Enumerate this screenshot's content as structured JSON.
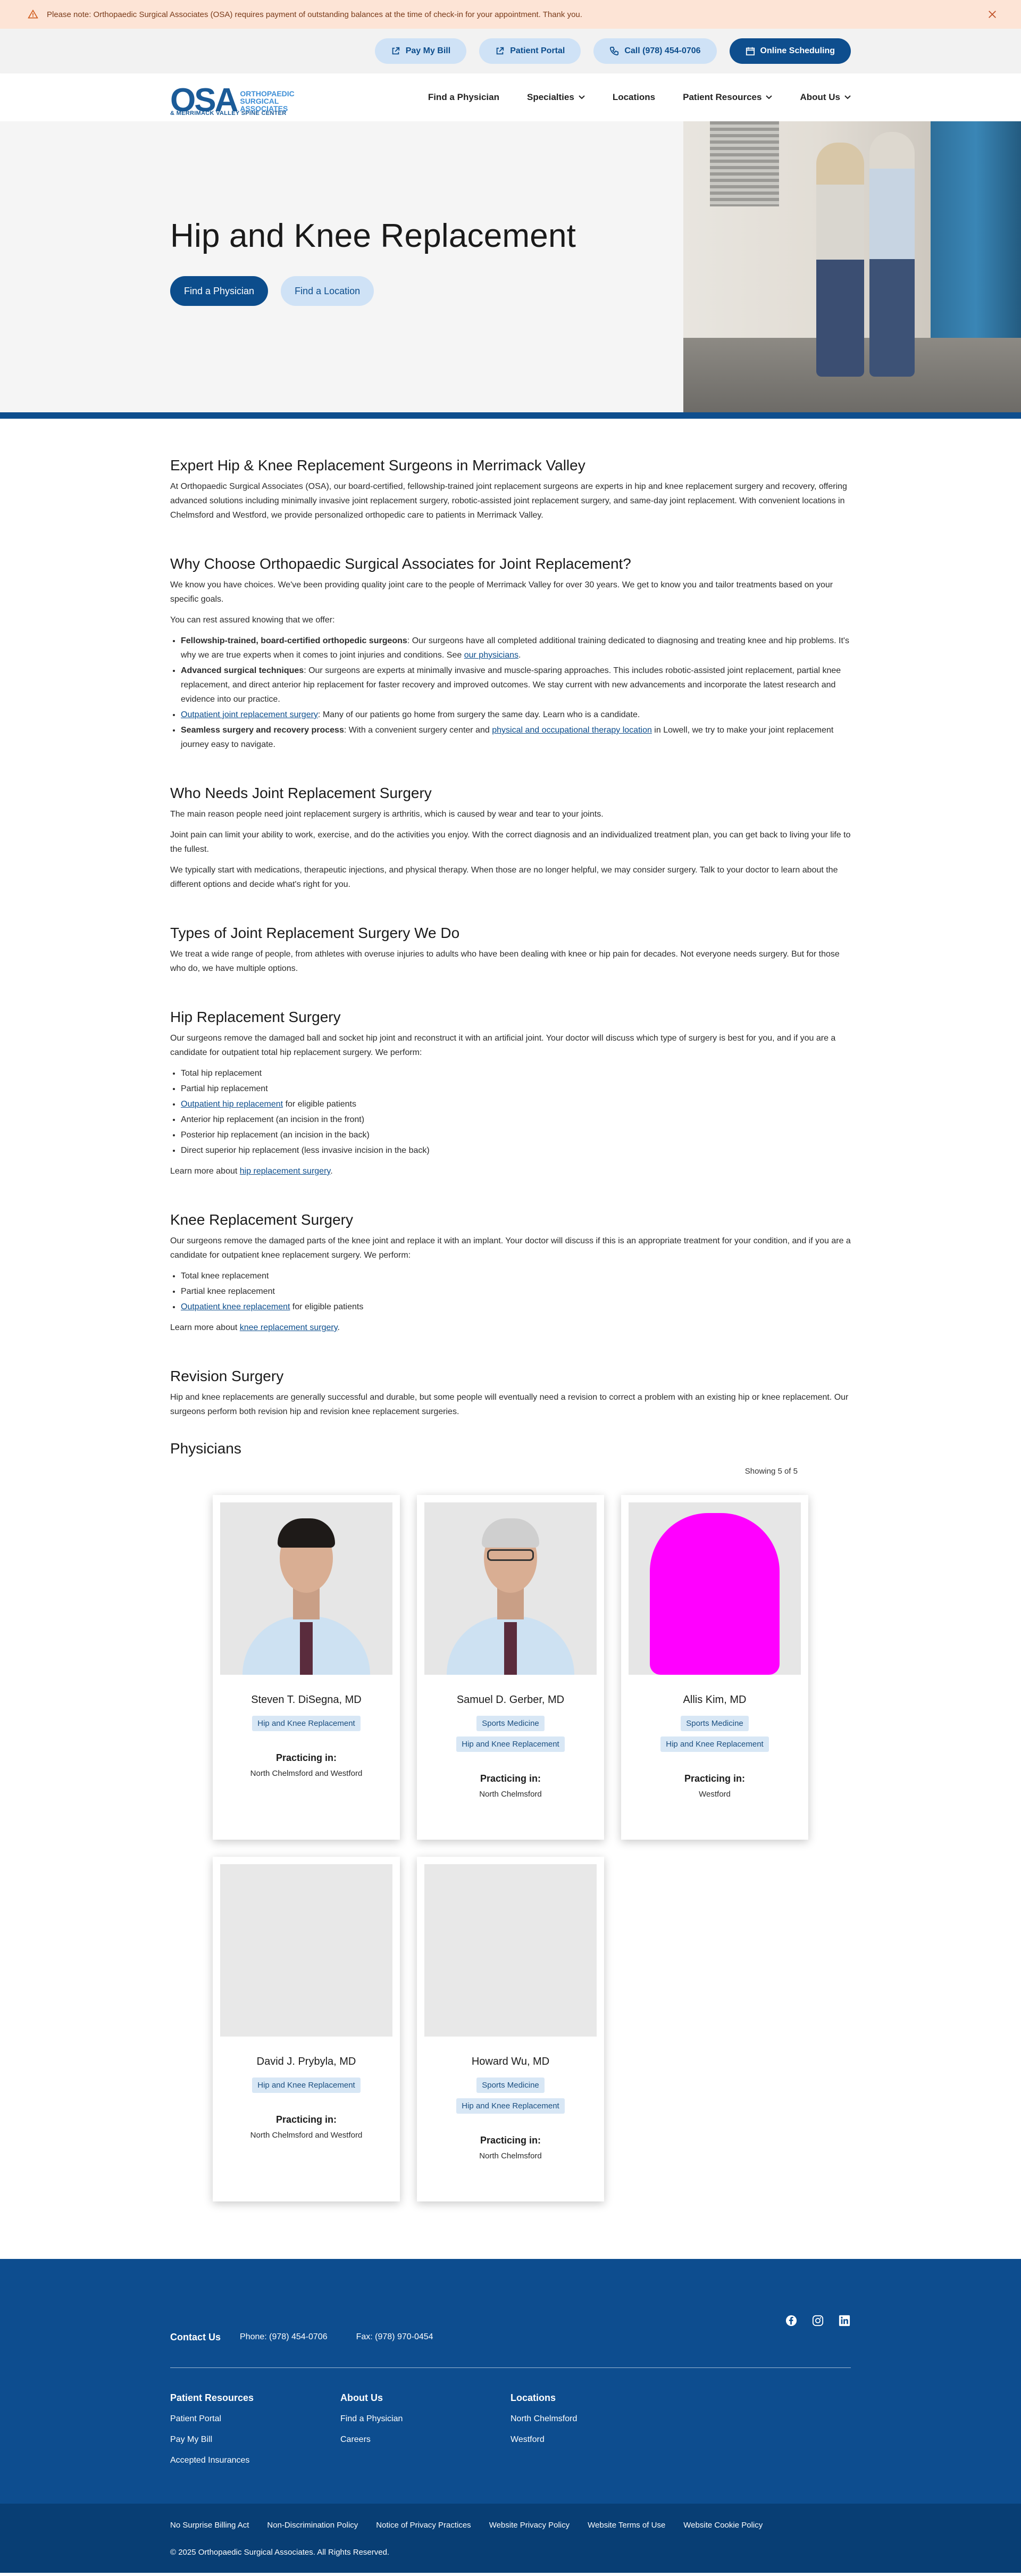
{
  "notice": {
    "text": "Please note: Orthopaedic Surgical Associates (OSA) requires payment of outstanding balances at the time of check-in for your appointment. Thank you.",
    "color": "#fde4d6"
  },
  "utility": {
    "pay_bill": "Pay My Bill",
    "portal": "Patient Portal",
    "phone": "Call (978) 454-0706",
    "scheduling": "Online Scheduling"
  },
  "logo": {
    "mark": "OSA",
    "name": "ORTHOPAEDIC SURGICAL ASSOCIATES",
    "sub": "& MERRIMACK VALLEY SPINE CENTER"
  },
  "nav": [
    "Find a Physician",
    "Specialties",
    "Locations",
    "Patient Resources",
    "About Us"
  ],
  "hero": {
    "title": "Hip and Knee Replacement",
    "btn_physician": "Find a Physician",
    "btn_location": "Find a Location"
  },
  "sections": {
    "s1": {
      "title": "Expert Hip & Knee Replacement Surgeons in Merrimack Valley",
      "p1": "At Orthopaedic Surgical Associates (OSA), our board-certified, fellowship-trained joint replacement surgeons are experts in hip and knee replacement surgery and recovery, offering advanced solutions including minimally invasive joint replacement surgery, robotic-assisted joint replacement surgery, and same-day joint replacement. With convenient locations in Chelmsford and Westford, we provide personalized orthopedic care to patients in Merrimack Valley."
    },
    "s2": {
      "title": "Why Choose Orthopaedic Surgical Associates for Joint Replacement?",
      "p1": "We know you have choices. We've been providing quality joint care to the people of Merrimack Valley for over 30 years. We get to know you and tailor treatments based on your specific goals.",
      "p2": "You can rest assured knowing that we offer:",
      "b1_strong": "Fellowship-trained, board-certified orthopedic surgeons",
      "b1_text": ": Our surgeons have all completed additional training dedicated to diagnosing and treating knee and hip problems. It's why we are true experts when it comes to joint injuries and conditions. See ",
      "b1_link": "our physicians",
      "b1_end": ".",
      "b2_strong": "Advanced surgical techniques",
      "b2_text": ": Our surgeons are experts at minimally invasive and muscle-sparing approaches. This includes robotic-assisted joint replacement, partial knee replacement, and direct anterior hip replacement for faster recovery and improved outcomes. We stay current with new advancements and incorporate the latest research and evidence into our practice.",
      "b3_link": "Outpatient joint replacement surgery",
      "b3_text": ": Many of our patients go home from surgery the same day. Learn who is a candidate.",
      "b4_strong": "Seamless surgery and recovery process",
      "b4_text": ": With a convenient surgery center and ",
      "b4_link": "physical and occupational therapy location",
      "b4_end": " in Lowell, we try to make your joint replacement journey easy to navigate."
    },
    "s3": {
      "title": "Who Needs Joint Replacement Surgery",
      "p1": "The main reason people need joint replacement surgery is arthritis, which is caused by wear and tear to your joints.",
      "p2": "Joint pain can limit your ability to work, exercise, and do the activities you enjoy. With the correct diagnosis and an individualized treatment plan, you can get back to living your life to the fullest.",
      "p3": "We typically start with medications, therapeutic injections, and physical therapy. When those are no longer helpful, we may consider surgery. Talk to your doctor to learn about the different options and decide what's right for you."
    },
    "s4": {
      "title": "Types of Joint Replacement Surgery We Do",
      "p1": "We treat a wide range of people, from athletes with overuse injuries to adults who have been dealing with knee or hip pain for decades. Not everyone needs surgery. But for those who do, we have multiple options."
    },
    "s5": {
      "title": "Hip Replacement Surgery",
      "p1": "Our surgeons remove the damaged ball and socket hip joint and reconstruct it with an artificial joint. Your doctor will discuss which type of surgery is best for you, and if you are a candidate for outpatient total hip replacement surgery. We perform:",
      "li1": "Total hip replacement",
      "li2": "Partial hip replacement",
      "li3_link": "Outpatient hip replacement",
      "li3_text": " for eligible patients",
      "li4": "Anterior hip replacement (an incision in the front)",
      "li5": "Posterior hip replacement (an incision in the back)",
      "li6": "Direct superior hip replacement (less invasive incision in the back)",
      "more": "Learn more about ",
      "more_link": "hip replacement surgery",
      "more_end": "."
    },
    "s6": {
      "title": "Knee Replacement Surgery",
      "p1": "Our surgeons remove the damaged parts of the knee joint and replace it with an implant. Your doctor will discuss if this is an appropriate treatment for your condition, and if you are a candidate for outpatient knee replacement surgery. We perform:",
      "li1": "Total knee replacement",
      "li2": "Partial knee replacement",
      "li3_link": "Outpatient knee replacement",
      "li3_text": " for eligible patients",
      "more": "Learn more about ",
      "more_link": "knee replacement surgery",
      "more_end": "."
    },
    "s7": {
      "title": "Revision Surgery",
      "p1": "Hip and knee replacements are generally successful and durable, but some people will eventually need a revision to correct a problem with an existing hip or knee replacement. Our surgeons perform both revision hip and revision knee replacement surgeries."
    }
  },
  "physicians": {
    "title": "Physicians",
    "showing": "Showing 5 of 5",
    "practicing_label": "Practicing in:",
    "list": [
      {
        "name": "Steven T. DiSegna, MD",
        "tags": [
          "Hip and Knee Replacement"
        ],
        "locations": "North Chelmsford and Westford"
      },
      {
        "name": "Samuel D. Gerber, MD",
        "tags": [
          "Sports Medicine",
          "Hip and Knee Replacement"
        ],
        "locations": "North Chelmsford"
      },
      {
        "name": "Allis Kim, MD",
        "tags": [
          "Sports Medicine",
          "Hip and Knee Replacement"
        ],
        "locations": "Westford"
      },
      {
        "name": "David J. Prybyla, MD",
        "tags": [
          "Hip and Knee Replacement"
        ],
        "locations": "North Chelmsford and Westford"
      },
      {
        "name": "Howard Wu, MD",
        "tags": [
          "Sports Medicine",
          "Hip and Knee Replacement"
        ],
        "locations": "North Chelmsford"
      }
    ]
  },
  "footer": {
    "contact_title": "Contact Us",
    "phone": "Phone: (978) 454-0706",
    "fax": "Fax: (978) 970-0454",
    "col1_title": "Patient Resources",
    "col1": [
      "Patient Portal",
      "Pay My Bill",
      "Accepted Insurances"
    ],
    "col2_title": "About Us",
    "col2": [
      "Find a Physician",
      "Careers"
    ],
    "col3_title": "Locations",
    "col3": [
      "North Chelmsford",
      "Westford"
    ],
    "legal": [
      "No Surprise Billing Act",
      "Non-Discrimination Policy",
      "Notice of Privacy Practices",
      "Website Privacy Policy",
      "Website Terms of Use",
      "Website Cookie Policy"
    ],
    "copyright": "© 2025 Orthopaedic Surgical Associates. All Rights Reserved."
  },
  "colors": {
    "brand": "#0e4e8e",
    "accent_light": "#cfe2f6",
    "footer": "#0d4d8f"
  }
}
